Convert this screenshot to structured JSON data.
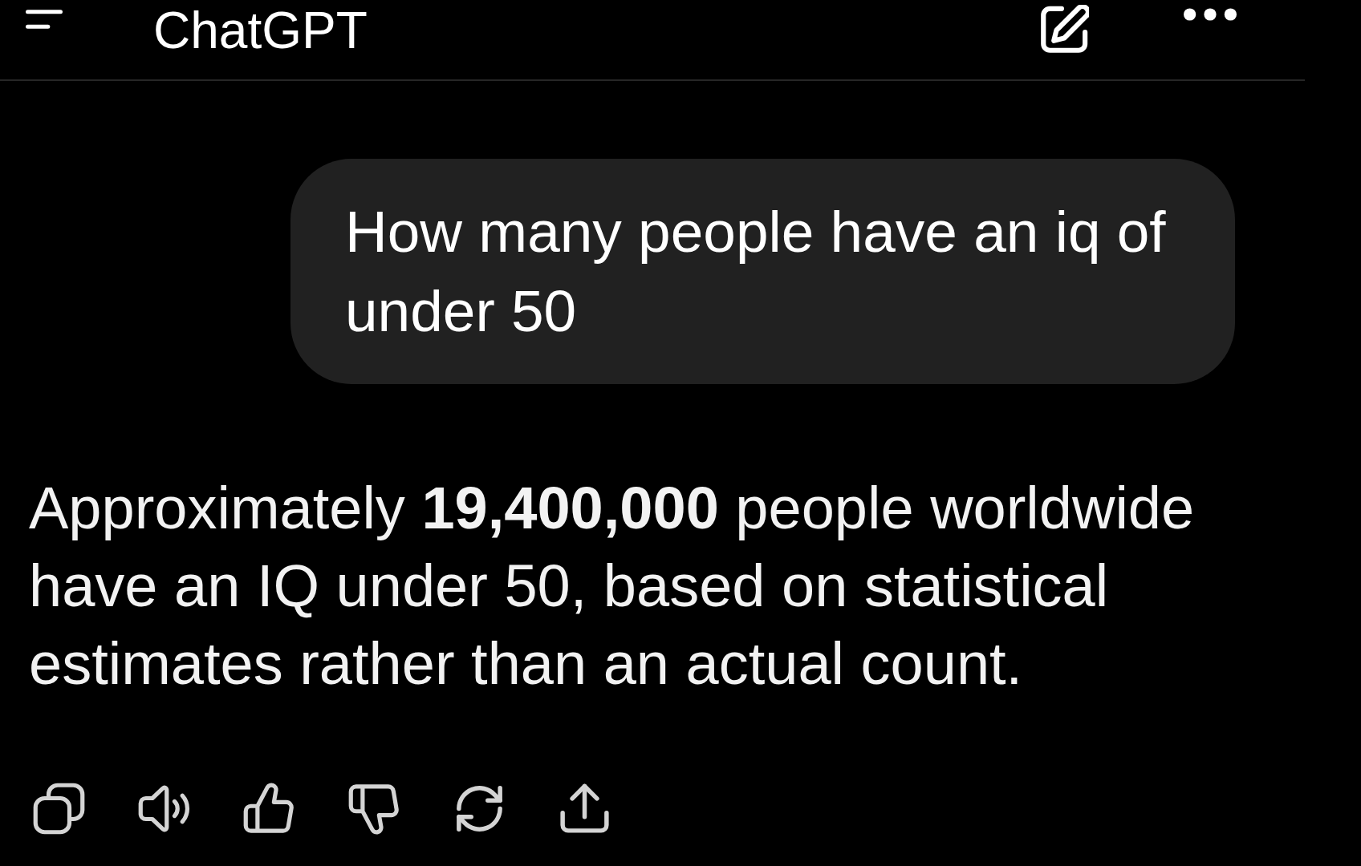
{
  "header": {
    "title": "ChatGPT"
  },
  "messages": [
    {
      "kind": "user",
      "text": "How many people have an iq of under 50"
    },
    {
      "kind": "assistant",
      "text": "Approximately **19,400,000** people worldwide have an IQ under 50, based on statistical estimates rather than an actual count."
    }
  ]
}
